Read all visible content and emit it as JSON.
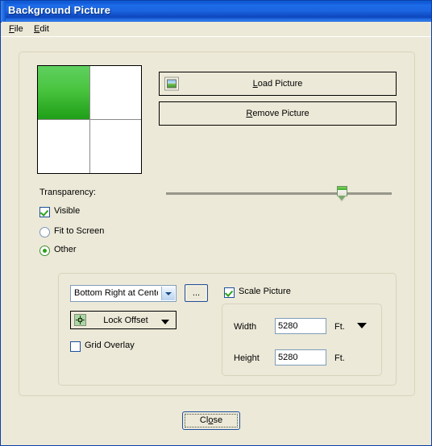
{
  "window": {
    "title": "Background Picture"
  },
  "menubar": {
    "items": [
      {
        "label_pre": "",
        "label_key": "F",
        "label_post": "ile",
        "name": "file"
      },
      {
        "label_pre": "",
        "label_key": "E",
        "label_post": "dit",
        "name": "edit"
      }
    ],
    "file_key": "F",
    "file_rest": "ile",
    "edit_key": "E",
    "edit_rest": "dit"
  },
  "preview": {
    "name": "picture-preview",
    "filled_quadrant": "top-left",
    "fill_color_top": "#5fd05f",
    "fill_color_bottom": "#1f9e18"
  },
  "buttons": {
    "load_key": "L",
    "load_rest": "oad Picture",
    "remove_key": "R",
    "remove_rest": "emove Picture",
    "browse_label": "...",
    "close_pre": "Cl",
    "close_key": "o",
    "close_post": "se"
  },
  "transparency": {
    "label": "Transparency:",
    "value_percent": 76
  },
  "options": {
    "visible_label": "Visible",
    "visible_checked": true,
    "fit_to_screen_label": "Fit to Screen",
    "fit_to_screen_selected": false,
    "other_label": "Other",
    "other_selected": true
  },
  "placement": {
    "position_value": "Bottom Right at Center",
    "lock_offset_label": "Lock Offset",
    "grid_overlay_label": "Grid Overlay",
    "grid_overlay_checked": false
  },
  "scale": {
    "scale_picture_label": "Scale Picture",
    "scale_picture_checked": true,
    "width_label": "Width",
    "width_value": "5280",
    "width_units": "Ft.",
    "height_label": "Height",
    "height_value": "5280",
    "height_units": "Ft."
  },
  "colors": {
    "title_bar_blue": "#1158d6",
    "dialog_face": "#ece9d8",
    "accent_green": "#2da11a",
    "input_border": "#7f9db9"
  }
}
